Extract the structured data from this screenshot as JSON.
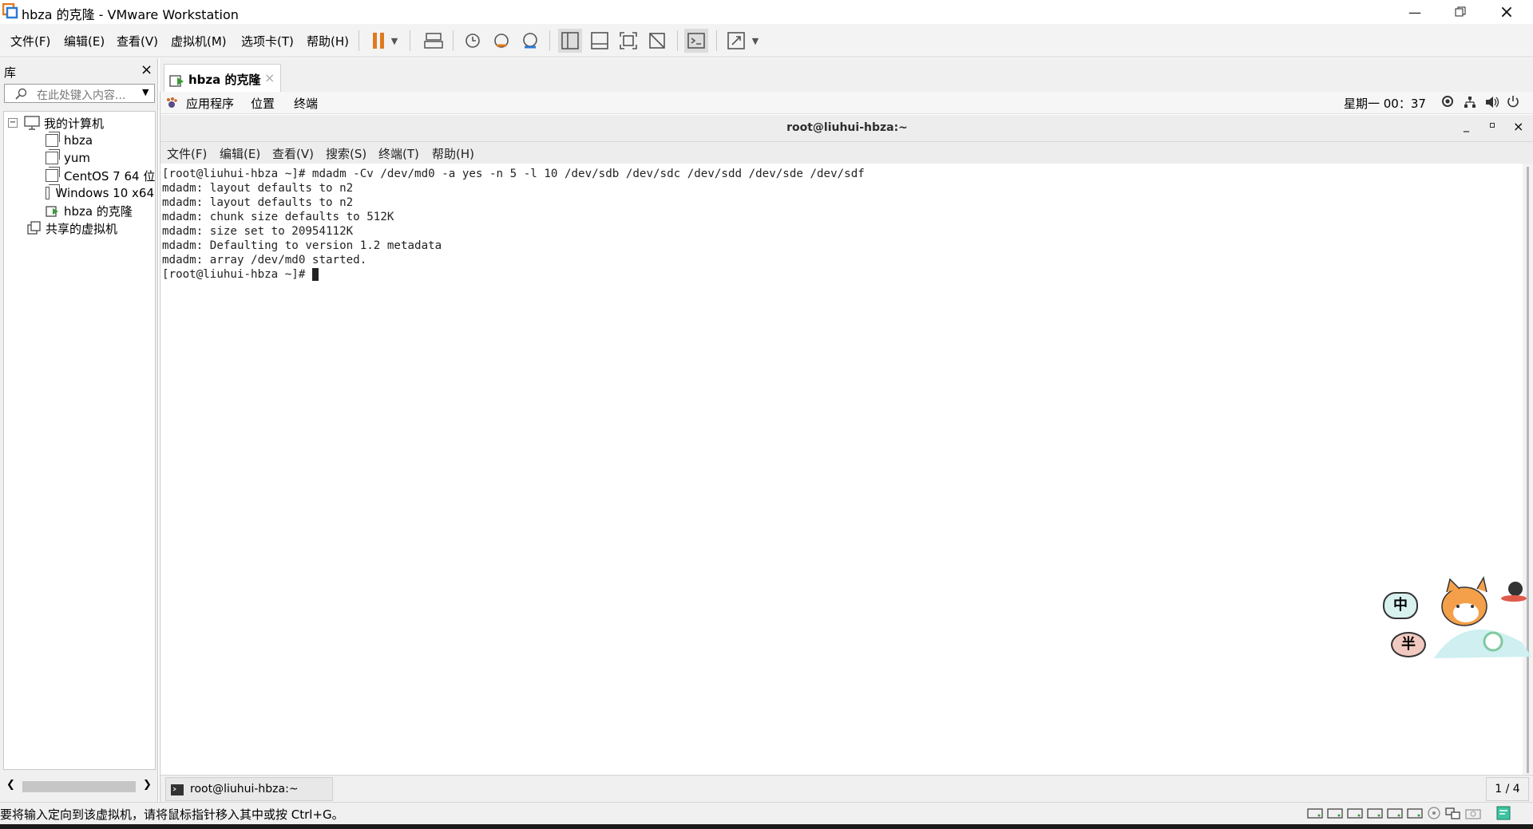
{
  "window": {
    "title": "hbza 的克隆 - VMware Workstation"
  },
  "menubar": {
    "items": [
      "文件(F)",
      "编辑(E)",
      "查看(V)",
      "虚拟机(M)",
      "选项卡(T)",
      "帮助(H)"
    ]
  },
  "library": {
    "title": "库",
    "search_placeholder": "在此处键入内容...",
    "tree": {
      "root": "我的计算机",
      "vms": [
        "hbza",
        "yum",
        "CentOS 7 64 位",
        "Windows 10 x64",
        "hbza 的克隆"
      ],
      "shared": "共享的虚拟机"
    }
  },
  "tab": {
    "label": "hbza 的克隆"
  },
  "gnome": {
    "apps": "应用程序",
    "places": "位置",
    "terminal": "终端",
    "clock": "星期一 00：37"
  },
  "terminal": {
    "title": "root@liuhui-hbza:~",
    "menu": [
      "文件(F)",
      "编辑(E)",
      "查看(V)",
      "搜索(S)",
      "终端(T)",
      "帮助(H)"
    ],
    "lines": [
      "[root@liuhui-hbza ~]# mdadm -Cv /dev/md0 -a yes -n 5 -l 10 /dev/sdb /dev/sdc /dev/sdd /dev/sde /dev/sdf",
      "mdadm: layout defaults to n2",
      "mdadm: layout defaults to n2",
      "mdadm: chunk size defaults to 512K",
      "mdadm: size set to 20954112K",
      "mdadm: Defaulting to version 1.2 metadata",
      "mdadm: array /dev/md0 started.",
      "[root@liuhui-hbza ~]# "
    ]
  },
  "taskbar": {
    "task_label": "root@liuhui-hbza:~",
    "workspace": "1 / 4"
  },
  "statusbar": {
    "message": "要将输入定向到该虚拟机，请将鼠标指针移入其中或按 Ctrl+G。"
  },
  "overlay": {
    "ime_chars": [
      "中",
      "半"
    ]
  },
  "colors": {
    "pause": "#e07a1f",
    "accent": "#2b7bd1"
  }
}
